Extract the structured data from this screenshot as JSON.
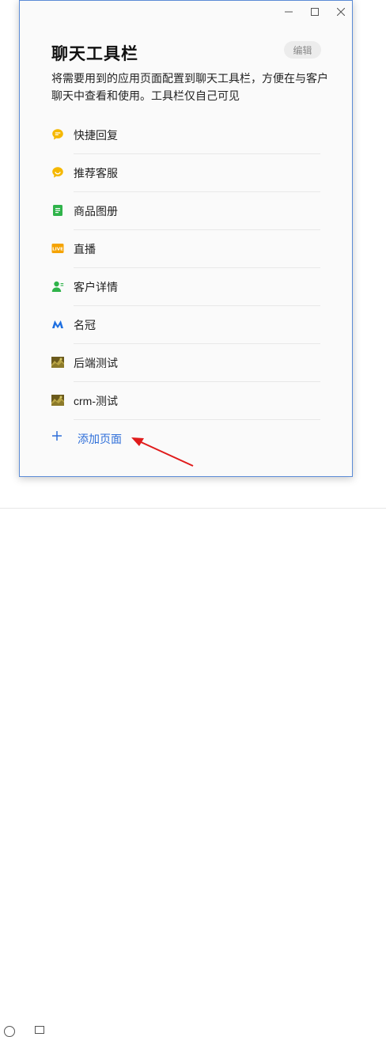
{
  "dialog": {
    "title": "聊天工具栏",
    "edit_label": "编辑",
    "description": "将需要用到的应用页面配置到聊天工具栏，方便在与客户聊天中查看和使用。工具栏仅自己可见"
  },
  "items": [
    {
      "label": "快捷回复",
      "icon": "quick-reply-icon",
      "color": "#f5b800"
    },
    {
      "label": "推荐客服",
      "icon": "recommend-service-icon",
      "color": "#f5b800"
    },
    {
      "label": "商品图册",
      "icon": "product-album-icon",
      "color": "#2fb34a"
    },
    {
      "label": "直播",
      "icon": "live-icon",
      "color": "#f5a300"
    },
    {
      "label": "客户详情",
      "icon": "customer-detail-icon",
      "color": "#2fb34a"
    },
    {
      "label": "名冠",
      "icon": "mingguan-icon",
      "color": "#1e6fe0"
    },
    {
      "label": "后端测试",
      "icon": "app-thumbnail-icon",
      "color": "#8a7a2a"
    },
    {
      "label": "crm-测试",
      "icon": "app-thumbnail-icon",
      "color": "#8a7a2a"
    }
  ],
  "add_page": {
    "label": "添加页面",
    "color": "#2f6fd9"
  },
  "annotation": {
    "arrow_color": "#e01b1b"
  }
}
